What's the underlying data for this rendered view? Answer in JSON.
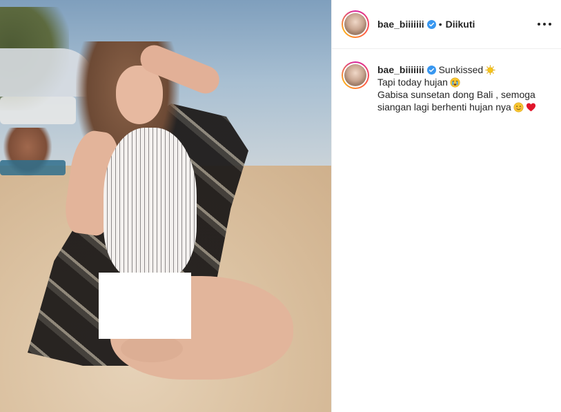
{
  "post": {
    "author": {
      "username": "bae_biiiiiii",
      "verified": true,
      "separator": "•",
      "follow_status": "Diikuti"
    },
    "more_icon": "more-horizontal-icon",
    "caption": {
      "username": "bae_biiiiiii",
      "first_text": "Sunkissed",
      "first_emoji": "sun-icon",
      "line2_text": "Tapi today hujan",
      "line2_emoji": "crying-face-icon",
      "line3_text": "Gabisa sunsetan dong Bali , semoga",
      "line4_text": "siangan lagi berhenti hujan nya",
      "line4_emojis": [
        "smiling-face-icon",
        "red-heart-icon"
      ]
    },
    "colors": {
      "verified_badge": "#3897f0",
      "story_ring": [
        "#d6249f",
        "#fd5949",
        "#fdae1c"
      ],
      "heart": "#e0162b",
      "sun": "#f5c418"
    }
  }
}
